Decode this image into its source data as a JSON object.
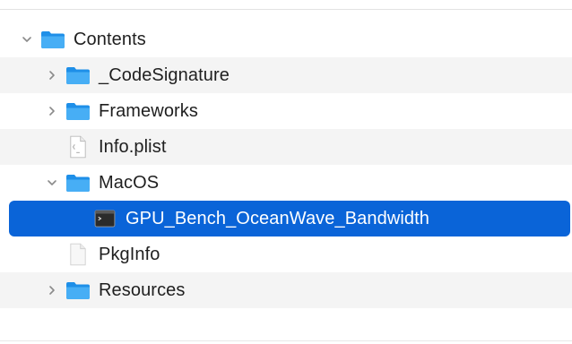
{
  "colors": {
    "folder": "#2a9cf0",
    "selection": "#0a64d8",
    "alt_row": "#f4f4f4"
  },
  "tree": {
    "items": [
      {
        "label": "Contents",
        "icon": "folder-icon",
        "expanded": true
      },
      {
        "label": "_CodeSignature",
        "icon": "folder-icon",
        "expanded": false
      },
      {
        "label": "Frameworks",
        "icon": "folder-icon",
        "expanded": false
      },
      {
        "label": "Info.plist",
        "icon": "plist-file-icon"
      },
      {
        "label": "MacOS",
        "icon": "folder-icon",
        "expanded": true
      },
      {
        "label": "GPU_Bench_OceanWave_Bandwidth",
        "icon": "executable-icon",
        "selected": true
      },
      {
        "label": "PkgInfo",
        "icon": "blank-file-icon"
      },
      {
        "label": "Resources",
        "icon": "folder-icon",
        "expanded": false
      }
    ]
  }
}
